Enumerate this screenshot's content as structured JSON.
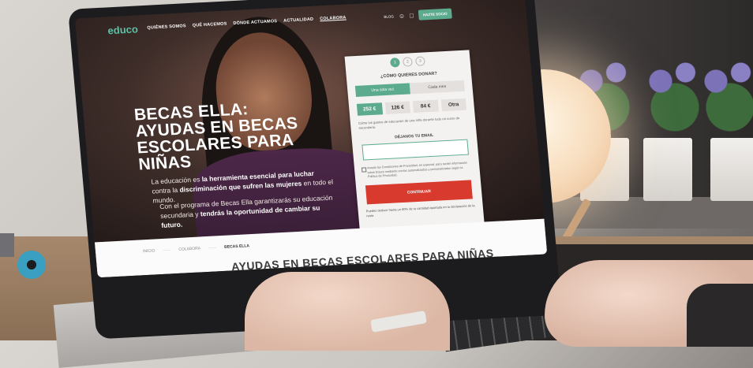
{
  "nav": {
    "logo": "educo",
    "menu": [
      "QUIÉNES SOMOS",
      "QUÉ HACEMOS",
      "DÓNDE ACTUAMOS",
      "ACTUALIDAD",
      "COLABORA"
    ],
    "blog": "BLOG",
    "cta": "HAZTE SOCIO"
  },
  "hero": {
    "title": "BECAS ELLA: AYUDAS EN BECAS ESCOLARES PARA NIÑAS",
    "p1_a": "La educación es ",
    "p1_b": "la herramienta esencial para luchar",
    "p1_c": " contra la ",
    "p1_d": "discriminación que sufren las mujeres",
    "p1_e": " en todo el mundo.",
    "p2_a": "Con el programa de Becas Ella garantizarás su educación secundaria y ",
    "p2_b": "tendrás la oportunidad de cambiar su futuro."
  },
  "form": {
    "steps": [
      "1",
      "2",
      "3"
    ],
    "question": "¿CÓMO QUIERES DONAR?",
    "tab_once": "Una sola vez",
    "tab_monthly": "Cada mes",
    "amounts": [
      "252 €",
      "126 €",
      "84 €",
      "Otra"
    ],
    "description": "Cubre los gastos de educación de una niña durante todo un curso de secundaria.",
    "email_label": "DÉJANOS TU EMAIL",
    "legal": "Acepto las Condiciones de Privacidad, en especial, para recibir información sobre Educo mediante envíos automatizados y personalizados según la Política de Privacidad.",
    "button": "CONTINUAR",
    "footer": "Puedes deducir hasta un 80% de tu cantidad aportada en tu declaración de la renta"
  },
  "breadcrumb": [
    "INICIO",
    "COLABORA",
    "BECAS ELLA"
  ],
  "section_title": "AYUDAS EN BECAS ESCOLARES PARA NIÑAS",
  "colors": {
    "accent": "#5cab8f",
    "cta": "#d83a2e"
  }
}
